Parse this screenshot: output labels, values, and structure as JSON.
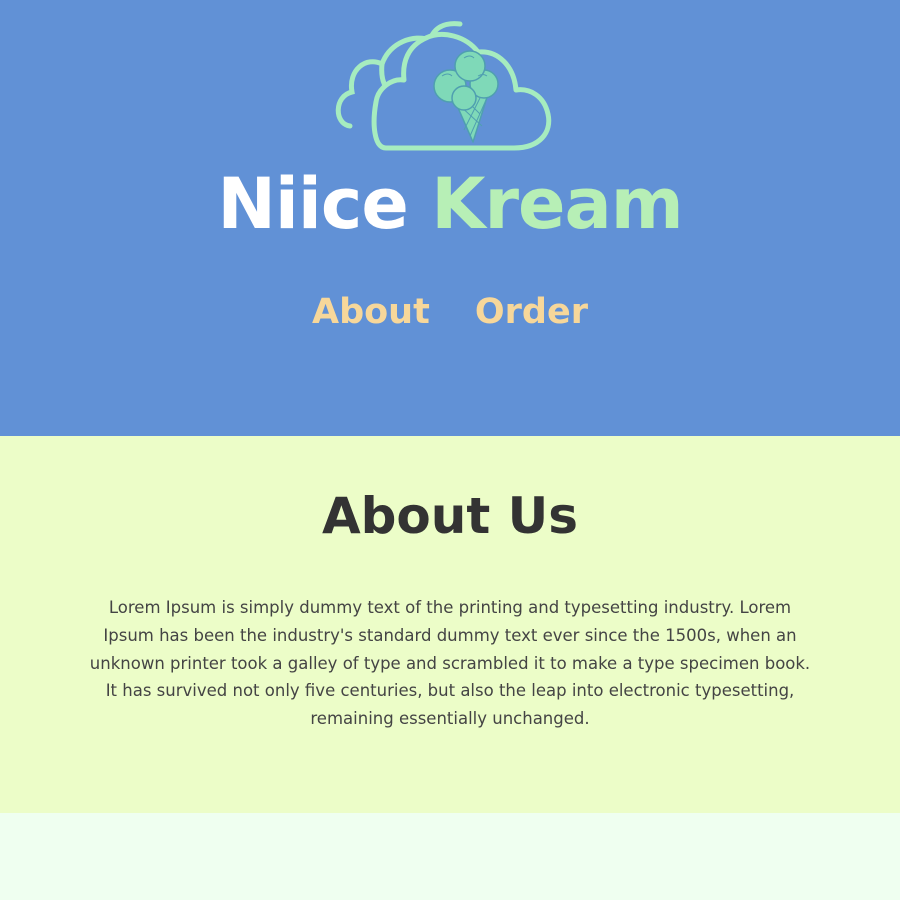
{
  "header": {
    "brand_part1": "Niice",
    "brand_part2": "Kream",
    "logo_icon": "cloud-ice-cream-icon",
    "colors": {
      "background": "#6191d6",
      "brand_white": "#ffffff",
      "brand_green": "#b7efb6",
      "nav": "#f7d79a"
    }
  },
  "nav": {
    "items": [
      {
        "label": "About"
      },
      {
        "label": "Order"
      }
    ]
  },
  "about": {
    "title": "About Us",
    "body": "Lorem Ipsum is simply dummy text of the printing and typesetting industry. Lorem Ipsum has been the industry's standard dummy text ever since the 1500s, when an unknown printer took a galley of type and scrambled it to make a type specimen book. It has survived not only five centuries, but also the leap into electronic typesetting, remaining essentially unchanged.",
    "colors": {
      "background": "#ecfdc8",
      "text": "#333333"
    }
  },
  "footer": {
    "colors": {
      "background": "#effff0"
    }
  }
}
